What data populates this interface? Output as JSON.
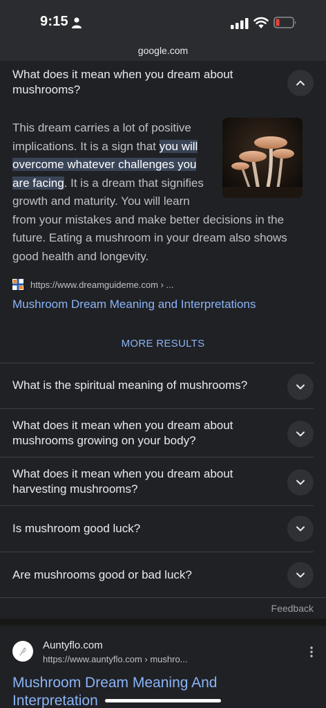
{
  "status": {
    "time": "9:15"
  },
  "browser": {
    "url": "google.com"
  },
  "expanded_question": {
    "text": "What does it mean when you dream about mushrooms?",
    "answer_part1": "This dream carries a lot of positive implications. It is a sign that ",
    "answer_highlight": "you will overcome whatever challenges you are facing",
    "answer_part2": ". It is a dream that signifies growth and maturity. You will learn from your mistakes and make better decisions in the future. Eating a mushroom in your dream also shows good health and longevity.",
    "image_icon": "mushroom-photo",
    "source_url": "https://www.dreamguideme.com › ...",
    "source_title": "Mushroom Dream Meaning and Interpretations"
  },
  "more_results_label": "MORE RESULTS",
  "questions": [
    {
      "text": "What is the spiritual meaning of mushrooms?"
    },
    {
      "text": "What does it mean when you dream about mushrooms growing on your body?"
    },
    {
      "text": "What does it mean when you dream about harvesting mushrooms?"
    },
    {
      "text": "Is mushroom good luck?"
    },
    {
      "text": "Are mushrooms good or bad luck?"
    }
  ],
  "feedback_label": "Feedback",
  "result": {
    "site_name": "Auntyflo.com",
    "site_url": "https://www.auntyflo.com › mushro...",
    "title": "Mushroom Dream Meaning And Interpretation"
  },
  "colors": {
    "background": "#202124",
    "link": "#8ab4f8",
    "highlight": "#394457",
    "battery_low": "#ea4335"
  }
}
